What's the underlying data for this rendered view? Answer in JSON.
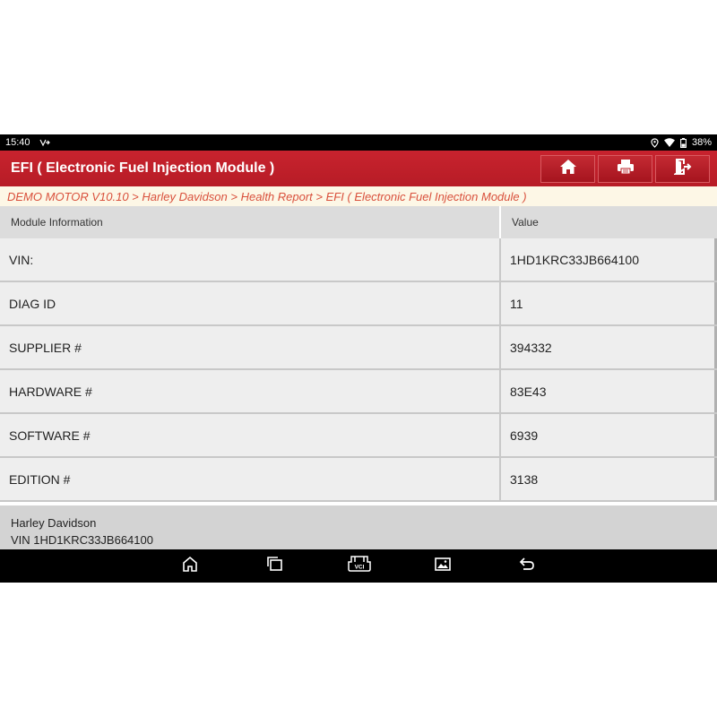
{
  "status_bar": {
    "time": "15:40",
    "battery": "38%"
  },
  "header": {
    "title": "EFI ( Electronic Fuel Injection Module )"
  },
  "breadcrumb": "DEMO MOTOR V10.10 > Harley Davidson > Health Report > EFI ( Electronic Fuel Injection Module )",
  "table": {
    "col_module": "Module Information",
    "col_value": "Value",
    "rows": [
      {
        "label": "VIN:",
        "value": "1HD1KRC33JB664100"
      },
      {
        "label": "DIAG ID",
        "value": "11"
      },
      {
        "label": "SUPPLIER #",
        "value": "394332"
      },
      {
        "label": "HARDWARE #",
        "value": "83E43"
      },
      {
        "label": "SOFTWARE #",
        "value": "6939"
      },
      {
        "label": "EDITION #",
        "value": "3138"
      }
    ]
  },
  "footer": {
    "make": "Harley Davidson",
    "vin": "VIN 1HD1KRC33JB664100"
  },
  "nav_icons": {
    "vci_label": "VCI"
  },
  "colors": {
    "header_red": "#c8232e",
    "breadcrumb_text": "#d9503c",
    "breadcrumb_bg": "#fdf7e6"
  }
}
